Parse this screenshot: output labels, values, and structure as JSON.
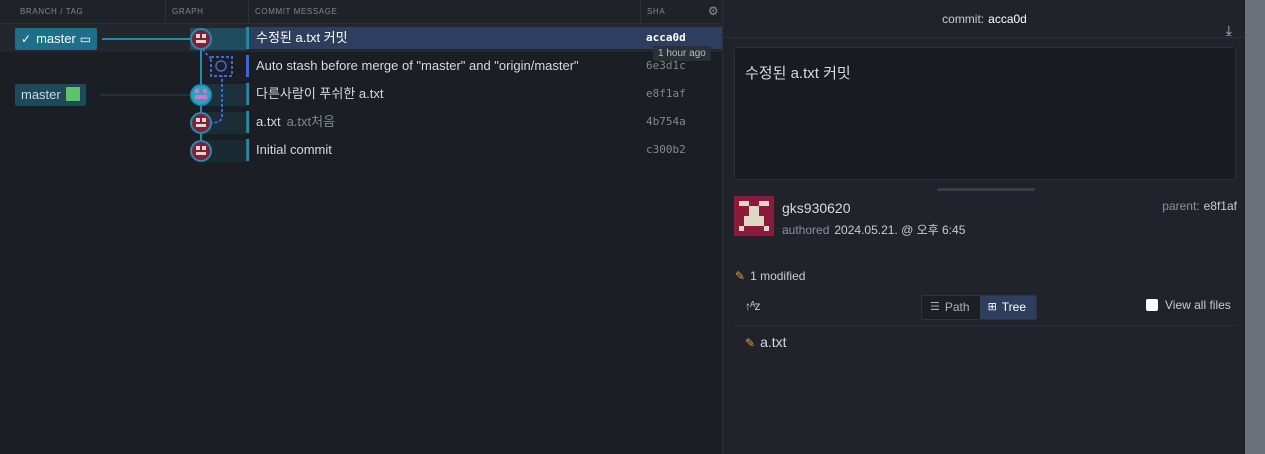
{
  "columns": {
    "branch_tag": "BRANCH / TAG",
    "graph": "GRAPH",
    "commit_message": "COMMIT MESSAGE",
    "sha": "SHA"
  },
  "branches": [
    {
      "label": "master",
      "icon": "laptop-icon",
      "checked": true
    },
    {
      "label": "master",
      "icon": "remote-avatar"
    }
  ],
  "commits": [
    {
      "message": "수정된 a.txt 커밋",
      "desc": "",
      "sha": "acca0d"
    },
    {
      "message": "Auto stash before merge of \"master\" and \"origin/master\"",
      "desc": "",
      "sha": "6e3d1c"
    },
    {
      "message": "다른사람이 푸쉬한 a.txt",
      "desc": "",
      "sha": "e8f1af"
    },
    {
      "message": "a.txt",
      "desc": "a.txt처음",
      "sha": "4b754a"
    },
    {
      "message": "Initial commit",
      "desc": "",
      "sha": "c300b2"
    }
  ],
  "tooltip": "1 hour ago",
  "detail": {
    "commit_label": "commit:",
    "commit_sha": "acca0d",
    "message": "수정된 a.txt  커밋",
    "author": "gks930620",
    "authored_label": "authored",
    "authored_date": "2024.05.21. @ 오후 6:45",
    "parent_label": "parent:",
    "parent_sha": "e8f1af",
    "modified": "1 modified",
    "view_path": "Path",
    "view_tree": "Tree",
    "view_all": "View all files",
    "file": "a.txt"
  },
  "colors": {
    "accent": "#1c8fb0",
    "selection": "#2d3e5e",
    "avatar_bg": "#8b1a3b",
    "pencil": "#e0a030"
  }
}
